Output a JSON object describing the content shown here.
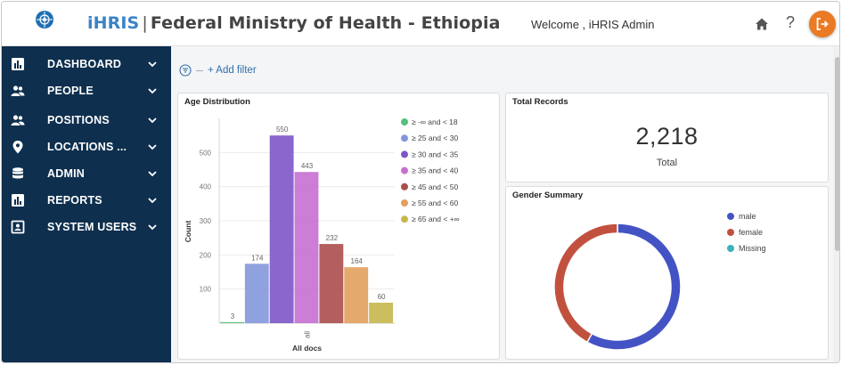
{
  "header": {
    "brand": "iHRIS",
    "separator": "|",
    "org": "Federal Ministry of Health - Ethiopia",
    "welcome": "Welcome , iHRIS Admin",
    "help": "?"
  },
  "sidebar": {
    "items": [
      {
        "label": "DASHBOARD",
        "icon": "bar-chart-icon"
      },
      {
        "label": "PEOPLE",
        "icon": "people-icon"
      },
      {
        "label": "POSITIONS",
        "icon": "people-icon"
      },
      {
        "label": "LOCATIONS ...",
        "icon": "location-pin-icon"
      },
      {
        "label": "ADMIN",
        "icon": "database-icon"
      },
      {
        "label": "REPORTS",
        "icon": "bar-chart-icon"
      },
      {
        "label": "SYSTEM USERS",
        "icon": "id-card-icon"
      }
    ]
  },
  "toolbar": {
    "add_filter": "+ Add filter"
  },
  "panels": {
    "age": {
      "title": "Age Distribution"
    },
    "total": {
      "title": "Total Records",
      "value": "2,218",
      "label": "Total"
    },
    "gender": {
      "title": "Gender Summary"
    }
  },
  "chart_data": [
    {
      "type": "bar",
      "title": "Age Distribution",
      "xlabel": "All docs",
      "ylabel": "Count",
      "categories": [
        "all"
      ],
      "ylim": [
        0,
        600
      ],
      "yticks": [
        100,
        200,
        300,
        400,
        500
      ],
      "legend_position": "right",
      "series": [
        {
          "name": "≥ -∞ and < 18",
          "values": [
            3
          ],
          "color": "#55c07a"
        },
        {
          "name": "≥ 25 and < 30",
          "values": [
            174
          ],
          "color": "#8497dd"
        },
        {
          "name": "≥ 30 and < 35",
          "values": [
            550
          ],
          "color": "#7d55c8"
        },
        {
          "name": "≥ 35 and < 40",
          "values": [
            443
          ],
          "color": "#c76fd1"
        },
        {
          "name": "≥ 45 and < 50",
          "values": [
            232
          ],
          "color": "#ab4e4e"
        },
        {
          "name": "≥ 55 and < 60",
          "values": [
            164
          ],
          "color": "#e1a05c"
        },
        {
          "name": "≥ 65 and < +∞",
          "values": [
            60
          ],
          "color": "#c6b74d"
        }
      ]
    },
    {
      "type": "pie",
      "title": "Gender Summary",
      "donut": true,
      "legend_position": "right",
      "series": [
        {
          "name": "male",
          "value": 1285,
          "color": "#4453c4"
        },
        {
          "name": "female",
          "value": 933,
          "color": "#c1513e"
        },
        {
          "name": "Missing",
          "value": 0,
          "color": "#3bb3b7"
        }
      ]
    }
  ]
}
